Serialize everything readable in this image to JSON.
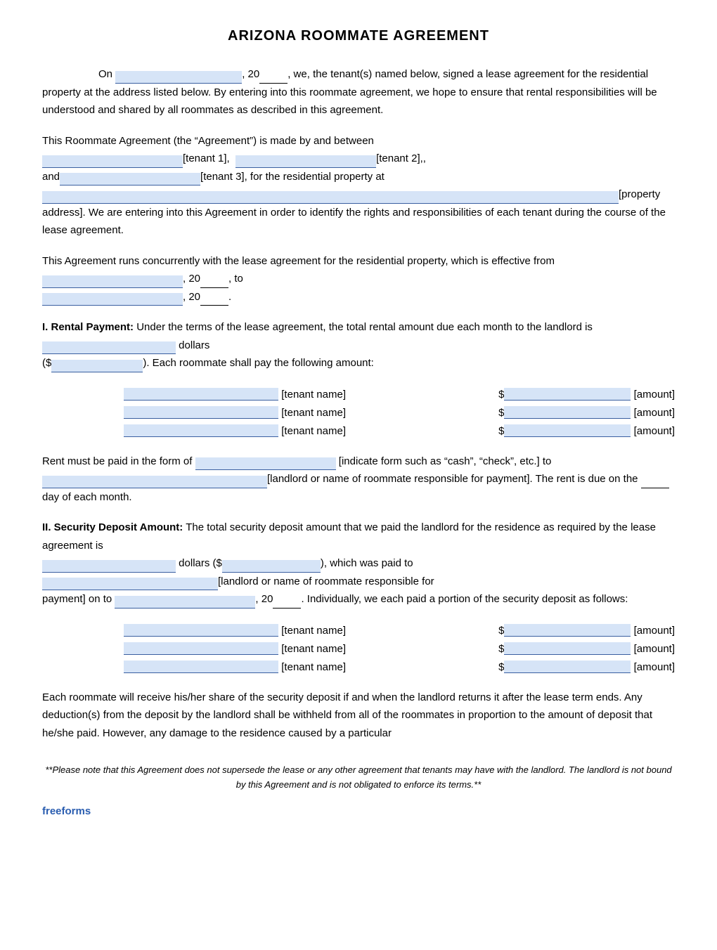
{
  "title": "ARIZONA ROOMMATE AGREEMENT",
  "intro": {
    "line1_pre": "On",
    "line1_post": ", 20",
    "line1_end": ", we, the tenant(s) named below, signed a lease agreement for the residential property at the address listed below. By entering into this roommate agreement, we hope to ensure that rental responsibilities will be understood and shared by all roommates as described in this agreement."
  },
  "agreement_intro": {
    "text1": "This Roommate Agreement (the “Agreement”) is made by and between",
    "tenant1_label": "[tenant 1],",
    "tenant2_label": "[tenant 2],,",
    "and_label": "and",
    "tenant3_label": "[tenant 3], for the residential property at",
    "property_label": "[property address]. We are entering into this Agreement in order to identify the rights and responsibilities of each tenant during the course of the lease agreement."
  },
  "concurrent": {
    "text": "This Agreement runs concurrently with the lease agreement for the residential property, which is effective from",
    "mid": ", 20",
    "to": ", to",
    "end": ", 20"
  },
  "section1": {
    "title": "I.  Rental Payment:",
    "body1": " Under the terms of the lease agreement, the total rental amount due each month to the landlord is",
    "dollars": "dollars",
    "paren_pre": "($",
    "paren_post": ").  Each roommate shall pay the following amount:",
    "tenants": [
      {
        "name_label": "[tenant name]",
        "amount_label": "[amount]"
      },
      {
        "name_label": "[tenant name]",
        "amount_label": "[amount]"
      },
      {
        "name_label": "[tenant name]",
        "amount_label": "[amount]"
      }
    ],
    "rent_form_pre": "Rent must be paid in the form of",
    "rent_form_indicate": "[indicate form such as “cash”, “check”, etc.] to",
    "landlord_label": "[landlord or name of roommate responsible for payment]. The rent is due on the",
    "day_label": "day of each month."
  },
  "section2": {
    "title": "II.  Security Deposit Amount:",
    "body1": " The total security deposit amount that we paid the landlord for the residence as required by the lease agreement is",
    "dollars_label": "dollars ($",
    "paid_to": "), which was paid to",
    "landlord_responsible": "[landlord or name of roommate responsible for",
    "payment_on": "payment] on to",
    "date_post": ", 20",
    "individually": ". Individually, we each paid a portion of the security deposit as follows:",
    "tenants": [
      {
        "name_label": "[tenant name]",
        "amount_label": "[amount]"
      },
      {
        "name_label": "[tenant name]",
        "amount_label": "[amount]"
      },
      {
        "name_label": "[tenant name]",
        "amount_label": "[amount]"
      }
    ]
  },
  "closing_para": "Each roommate will receive his/her share of the security deposit if and when the landlord returns it after the lease term ends. Any deduction(s) from the deposit by the landlord shall be withheld from all of the roommates in proportion to the amount of deposit that he/she paid. However, any damage to the residence caused by a particular",
  "footer": {
    "note": "**Please note that this Agreement does not supersede the lease or any other agreement that tenants may have with the landlord. The landlord is not bound by this Agreement and is not obligated to enforce its terms.**",
    "brand": "freeforms"
  }
}
